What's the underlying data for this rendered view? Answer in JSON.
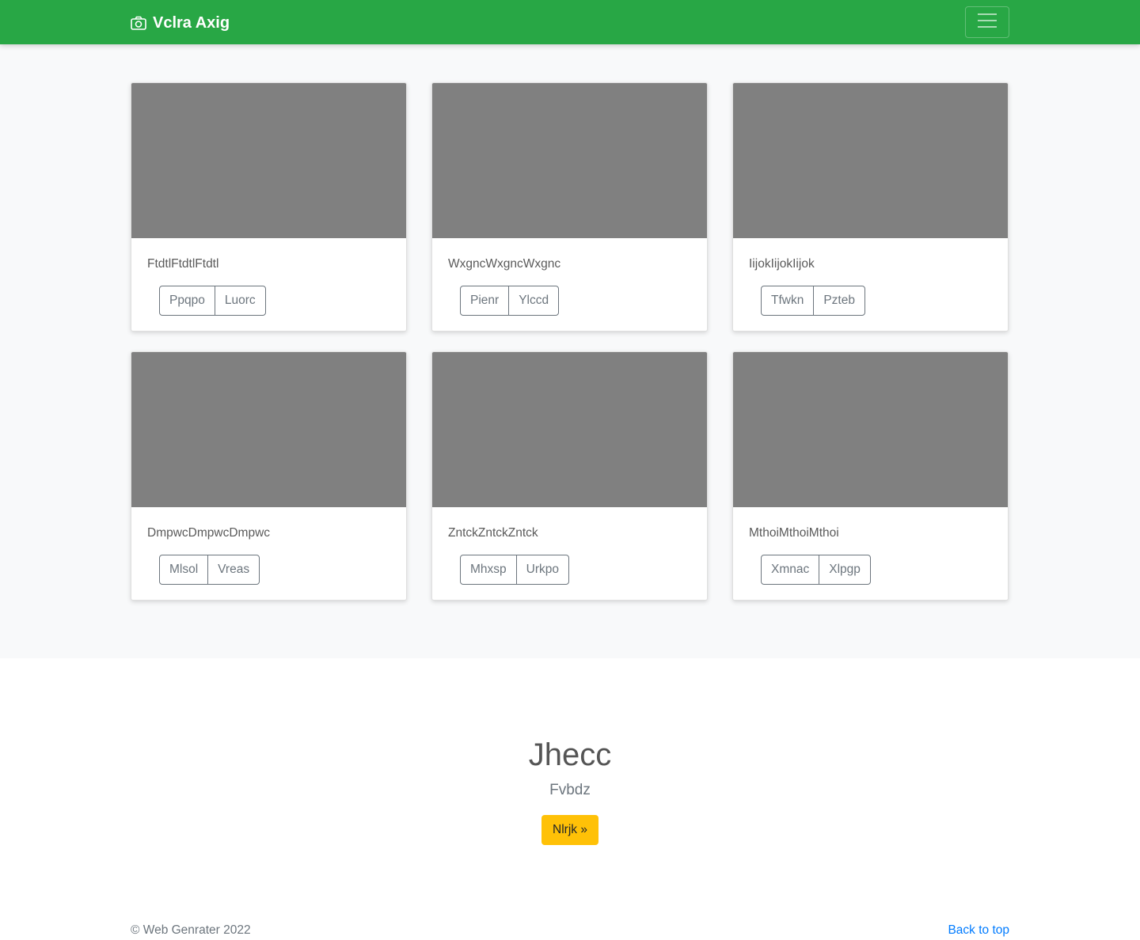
{
  "navbar": {
    "brand": "Vclra Axig",
    "brand_icon": "camera-icon",
    "toggler_icon": "hamburger-icon",
    "background": "#28a745"
  },
  "cards": [
    {
      "text": "FtdtlFtdtlFtdtl",
      "buttons": [
        "Ppqpo",
        "Luorc"
      ]
    },
    {
      "text": "WxgncWxgncWxgnc",
      "buttons": [
        "Pienr",
        "Ylccd"
      ]
    },
    {
      "text": "IijokIijokIijok",
      "buttons": [
        "Tfwkn",
        "Pzteb"
      ]
    },
    {
      "text": "DmpwcDmpwcDmpwc",
      "buttons": [
        "Mlsol",
        "Vreas"
      ]
    },
    {
      "text": "ZntckZntckZntck",
      "buttons": [
        "Mhxsp",
        "Urkpo"
      ]
    },
    {
      "text": "MthoiMthoiMthoi",
      "buttons": [
        "Xmnac",
        "Xlpgp"
      ]
    }
  ],
  "hero": {
    "title": "Jhecc",
    "subtitle": "Fvbdz",
    "button": "Nlrjk »",
    "button_color": "#ffc107"
  },
  "footer": {
    "copyright": "© Web Genrater 2022",
    "back_to_top": "Back to top",
    "link_color": "#007bff"
  }
}
